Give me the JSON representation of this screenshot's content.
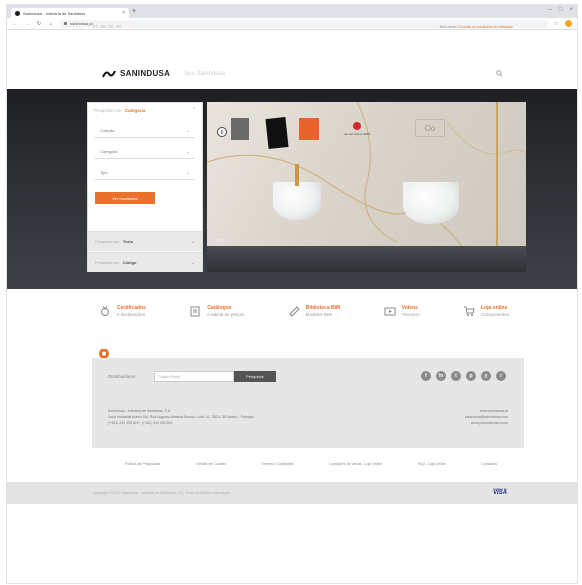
{
  "browser": {
    "tab_title": "Sanindusa - Indústria de Sanitários",
    "url": "sanindusa.pt"
  },
  "site": {
    "brand": "SANINDUSA",
    "tagline": "Sou Sanindusa",
    "notice_text": "Bem-vindo",
    "notice_link": "Consulte as condições de utilização"
  },
  "sidebar": {
    "header_prefix": "Pesquisar por",
    "header_value": "Categoria",
    "selects": [
      "Coleção",
      "Categoria",
      "Tipo"
    ],
    "search_button": "Ver resultados",
    "row1_label": "Pesquisar por",
    "row1_value": "Texto",
    "row2_label": "Pesquisar por",
    "row2_value": "Código"
  },
  "banner": {
    "award_text": "red dot winner 2022",
    "caption": "Oblique",
    "logo_text": "Oo"
  },
  "services": [
    {
      "title": "Certificados",
      "sub": "e declarações",
      "icon": "medal-icon"
    },
    {
      "title": "Catálogos",
      "sub": "e tabela de preços",
      "icon": "catalog-icon"
    },
    {
      "title": "Biblioteca BIM",
      "sub": "Modelos BIM",
      "icon": "bim-icon"
    },
    {
      "title": "Vídeos",
      "sub": "Técnicos",
      "icon": "video-icon"
    },
    {
      "title": "Loja online",
      "sub": "Componentes",
      "icon": "cart-icon"
    }
  ],
  "distributors": {
    "label": "Distribuidores",
    "placeholder": "Código Postal",
    "button": "Pesquisar",
    "socials": [
      "f",
      "in",
      "t",
      "p",
      "y",
      "i"
    ]
  },
  "contact": {
    "company": "Sanindusa - Indústria de Sanitários, S.A.",
    "address": "Zona Industrial Aveiro Sul, Rua Augusto Almeida Branco, Lote 14 - 3810-783 Aveiro - Portugal",
    "phones": "(+351) 234 303 620 · (+351) 234 303 629",
    "site1": "www.sanindusa.pt",
    "site2": "sanindusa@sanindusa.com",
    "site3": "www.pluscollection.com"
  },
  "footer_links": [
    "Política de Privacidade",
    "Gestão de Cookies",
    "Termos e Condições",
    "Condições de Venda - Loja Online",
    "FAQ - Loja Online",
    "Contactos"
  ],
  "copyright": "Copyright © 2022 Sanindusa - Indústria de Sanitários, S.A. Todos os direitos reservados.",
  "payment": {
    "label": "Verified by",
    "brand": "VISA"
  },
  "colors": {
    "accent": "#e8712c",
    "hero_bg": "#2e3035"
  }
}
